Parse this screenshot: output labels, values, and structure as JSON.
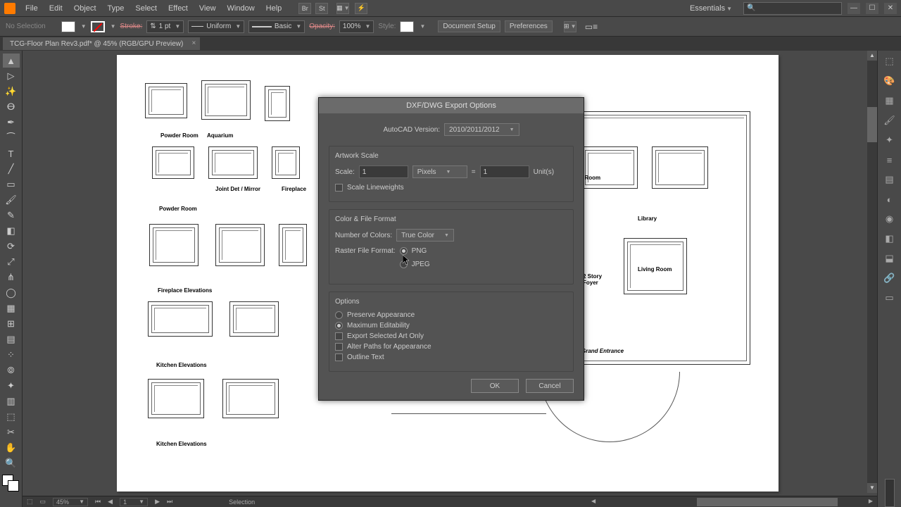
{
  "menu": {
    "items": [
      "File",
      "Edit",
      "Object",
      "Type",
      "Select",
      "Effect",
      "View",
      "Window",
      "Help"
    ],
    "workspace": "Essentials"
  },
  "controlbar": {
    "selection_state": "No Selection",
    "stroke_label": "Stroke:",
    "stroke_weight": "1 pt",
    "stroke_style": "Uniform",
    "brush_style": "Basic",
    "opacity_label": "Opacity:",
    "opacity_value": "100%",
    "style_label": "Style:",
    "doc_setup": "Document Setup",
    "preferences": "Preferences"
  },
  "tab": {
    "name": "TCG-Floor Plan Rev3.pdf* @ 45% (RGB/GPU Preview)"
  },
  "dialog": {
    "title": "DXF/DWG Export Options",
    "autocad_label": "AutoCAD Version:",
    "autocad_value": "2010/2011/2012",
    "group_scale": "Artwork Scale",
    "scale_label": "Scale:",
    "scale_value": "1",
    "scale_unit_dd": "Pixels",
    "scale_equals": "=",
    "scale_unit_value": "1",
    "scale_units_label": "Unit(s)",
    "scale_lineweights": "Scale Lineweights",
    "group_color": "Color & File Format",
    "num_colors_label": "Number of Colors:",
    "num_colors_value": "True Color",
    "raster_label": "Raster File Format:",
    "raster_png": "PNG",
    "raster_jpeg": "JPEG",
    "group_options": "Options",
    "opt_preserve": "Preserve Appearance",
    "opt_max_edit": "Maximum Editability",
    "opt_export_selected": "Export Selected Art Only",
    "opt_alter_paths": "Alter Paths for Appearance",
    "opt_outline_text": "Outline Text",
    "ok": "OK",
    "cancel": "Cancel"
  },
  "status": {
    "zoom": "45%",
    "page": "1",
    "tool": "Selection"
  },
  "floorplan_labels": {
    "powder1": "Powder Room",
    "aquarium": "Aquarium",
    "powder2": "Powder Room",
    "fireplace": "Fireplace Elevations",
    "kitchen1": "Kitchen Elevations",
    "kitchen2": "Kitchen Elevations",
    "joint": "Joint Det / Mirror",
    "fireplace2": "Fireplace",
    "library": "Library",
    "living": "Living Room",
    "foyer": "2 Story\nFoyer",
    "grand": "Grand Entrance",
    "and_room": "and Room"
  }
}
